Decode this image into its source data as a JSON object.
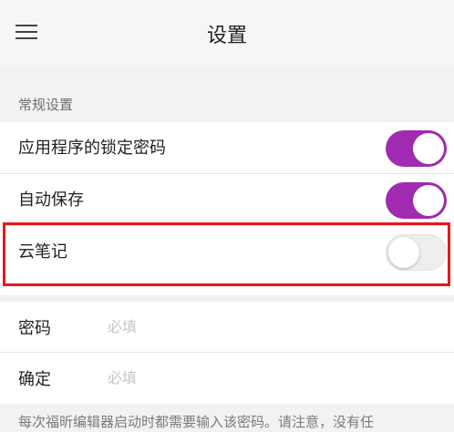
{
  "header": {
    "title": "设置",
    "menu_icon": "hamburger-menu-icon"
  },
  "general": {
    "section_title": "常规设置",
    "items": [
      {
        "label": "应用程序的锁定密码",
        "enabled": true
      },
      {
        "label": "自动保存",
        "enabled": true
      },
      {
        "label": "云笔记",
        "enabled": false
      }
    ]
  },
  "password": {
    "fields": [
      {
        "label": "密码",
        "placeholder": "必填"
      },
      {
        "label": "确定",
        "placeholder": "必填"
      }
    ],
    "note": "每次福昕编辑器启动时都需要输入该密码。请注意，没有任"
  },
  "colors": {
    "toggle_on": "#a02ab0",
    "toggle_off": "#eeeeee",
    "highlight_border": "#e41a1c"
  }
}
